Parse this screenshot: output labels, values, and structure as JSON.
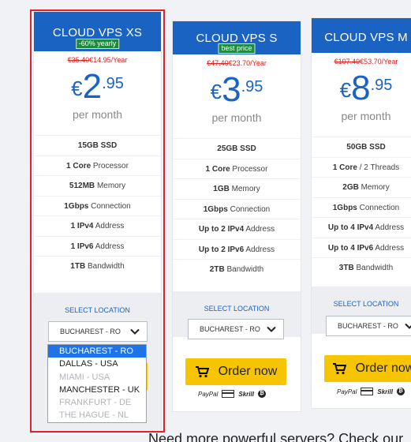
{
  "plans": [
    {
      "name": "CLOUD VPS XS",
      "badge": "-60% yearly",
      "old_price": "€35.40",
      "new_price": "€14.95/Year",
      "currency": "€",
      "price_int": "2",
      "price_dec": ".95",
      "period": "per month",
      "features": [
        {
          "b": "15GB SSD",
          "t": ""
        },
        {
          "b": "1 Core",
          "t": " Processor"
        },
        {
          "b": "512MB",
          "t": " Memory"
        },
        {
          "b": "1Gbps",
          "t": " Connection"
        },
        {
          "b": "1 IPv4",
          "t": " Address"
        },
        {
          "b": "1 IPv6",
          "t": " Address"
        },
        {
          "b": "1TB",
          "t": " Bandwidth"
        }
      ],
      "select_location_label": "SELECT LOCATION",
      "selected_location": "BUCHAREST - RO"
    },
    {
      "name": "CLOUD VPS S",
      "badge": "best price",
      "old_price": "€47.40",
      "new_price": "€23.70/Year",
      "currency": "€",
      "price_int": "3",
      "price_dec": ".95",
      "period": "per month",
      "features": [
        {
          "b": "25GB SSD",
          "t": ""
        },
        {
          "b": "1 Core",
          "t": " Processor"
        },
        {
          "b": "1GB",
          "t": " Memory"
        },
        {
          "b": "1Gbps",
          "t": " Connection"
        },
        {
          "b": "Up to 2 IPv4",
          "t": " Address"
        },
        {
          "b": "Up to 2 IPv6",
          "t": " Address"
        },
        {
          "b": "2TB",
          "t": " Bandwidth"
        }
      ],
      "select_location_label": "SELECT LOCATION",
      "selected_location": "BUCHAREST - RO",
      "order_label": "Order now",
      "payment": {
        "paypal": "PayPal",
        "skrill": "Skrill",
        "bitcoin": "₿"
      }
    },
    {
      "name": "CLOUD VPS M",
      "old_price": "€107.40",
      "new_price": "€53.70/Year",
      "currency": "€",
      "price_int": "8",
      "price_dec": ".95",
      "period": "per month",
      "features": [
        {
          "b": "50GB SSD",
          "t": ""
        },
        {
          "b": "1 Core",
          "t": " / 2 Threads"
        },
        {
          "b": "2GB",
          "t": " Memory"
        },
        {
          "b": "1Gbps",
          "t": " Connection"
        },
        {
          "b": "Up to 4 IPv4",
          "t": " Address"
        },
        {
          "b": "Up to 4 IPv6",
          "t": " Address"
        },
        {
          "b": "3TB",
          "t": " Bandwidth"
        }
      ],
      "select_location_label": "SELECT LOCATION",
      "selected_location": "BUCHAREST - RO",
      "order_label": "Order now",
      "payment": {
        "paypal": "PayPal",
        "skrill": "Skrill",
        "bitcoin": "₿"
      }
    }
  ],
  "dropdown_options": [
    {
      "label": "BUCHAREST - RO",
      "state": "selected"
    },
    {
      "label": "DALLAS - USA",
      "state": "enabled"
    },
    {
      "label": "MIAMI - USA",
      "state": "disabled"
    },
    {
      "label": "MANCHESTER - UK",
      "state": "enabled"
    },
    {
      "label": "FRANKFURT - DE",
      "state": "disabled"
    },
    {
      "label": "THE HAGUE - NL",
      "state": "disabled"
    }
  ],
  "footer_text": "Need more powerful servers? Check our",
  "colors": {
    "brand_blue": "#1b63c3",
    "badge_green": "#1e8a3c",
    "order_yellow": "#f7c400",
    "old_price_red": "#e02020",
    "highlight_red": "#e2202c",
    "option_selected_blue": "#1e73e8"
  }
}
